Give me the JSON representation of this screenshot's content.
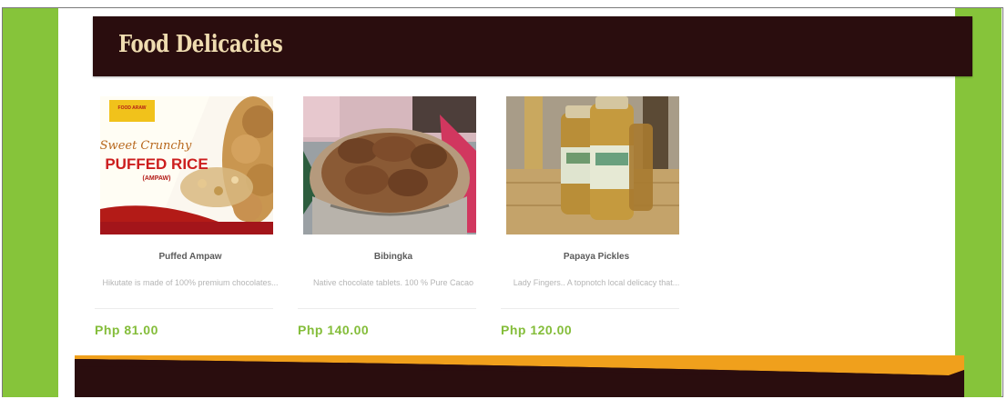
{
  "section": {
    "title": "Food Delicacies"
  },
  "products": [
    {
      "name": "Puffed Ampaw",
      "description": "Hikutate is made of 100% premium chocolates...",
      "price": "Php 81.00",
      "package": {
        "brand_badge": "FOOD ARAW",
        "tagline": "Sweet Crunchy",
        "product_line": "PUFFED RICE",
        "subtitle": "(AMPAW)"
      }
    },
    {
      "name": "Bibingka",
      "description": "Native chocolate tablets. 100 % Pure Cacao",
      "price": "Php 140.00"
    },
    {
      "name": "Papaya Pickles",
      "description": "Lady Fingers.. A topnotch local delicacy that...",
      "price": "Php 120.00"
    }
  ],
  "colors": {
    "side_band": "#86c43a",
    "header_bg": "#2a0d0e",
    "title": "#efdcb0",
    "price": "#84bd3a",
    "footer_orange": "#f0a01c"
  }
}
